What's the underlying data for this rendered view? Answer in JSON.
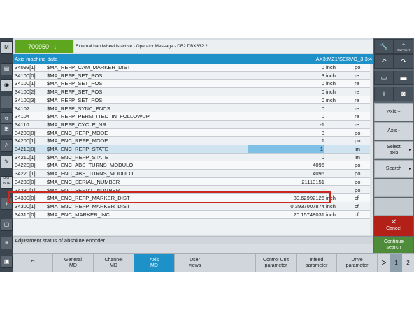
{
  "header": {
    "alarm_number": "700950",
    "alarm_arrow": "↓",
    "message": "External handwheel is active - Operator Message -   DB2.DBX632.2"
  },
  "window": {
    "title": "Axis machine data",
    "path": "AX3:MZ1/SERVO_3.3:4"
  },
  "table": {
    "rows": [
      {
        "num": "34093[1]",
        "name": "$MA_REFP_CAM_MARKER_DIST",
        "value": "0",
        "unit": "inch",
        "eff": "po"
      },
      {
        "num": "34100[0]",
        "name": "$MA_REFP_SET_POS",
        "value": "3",
        "unit": "inch",
        "eff": "re"
      },
      {
        "num": "34100[1]",
        "name": "$MA_REFP_SET_POS",
        "value": "0",
        "unit": "inch",
        "eff": "re"
      },
      {
        "num": "34100[2]",
        "name": "$MA_REFP_SET_POS",
        "value": "0",
        "unit": "inch",
        "eff": "re"
      },
      {
        "num": "34100[3]",
        "name": "$MA_REFP_SET_POS",
        "value": "0",
        "unit": "inch",
        "eff": "re"
      },
      {
        "num": "34102",
        "name": "$MA_REFP_SYNC_ENCS",
        "value": "0",
        "unit": "",
        "eff": "re"
      },
      {
        "num": "34104",
        "name": "$MA_REFP_PERMITTED_IN_FOLLOWUP",
        "value": "0",
        "unit": "",
        "eff": "re"
      },
      {
        "num": "34110",
        "name": "$MA_REFP_CYCLE_NR",
        "value": "-1",
        "unit": "",
        "eff": "re"
      },
      {
        "num": "34200[0]",
        "name": "$MA_ENC_REFP_MODE",
        "value": "0",
        "unit": "",
        "eff": "po"
      },
      {
        "num": "34200[1]",
        "name": "$MA_ENC_REFP_MODE",
        "value": "1",
        "unit": "",
        "eff": "po"
      },
      {
        "num": "34210[0]",
        "name": "$MA_ENC_REFP_STATE",
        "value": "1",
        "unit": "",
        "eff": "im"
      },
      {
        "num": "34210[1]",
        "name": "$MA_ENC_REFP_STATE",
        "value": "0",
        "unit": "",
        "eff": "im"
      },
      {
        "num": "34220[0]",
        "name": "$MA_ENC_ABS_TURNS_MODULO",
        "value": "4096",
        "unit": "",
        "eff": "po"
      },
      {
        "num": "34220[1]",
        "name": "$MA_ENC_ABS_TURNS_MODULO",
        "value": "4096",
        "unit": "",
        "eff": "po"
      },
      {
        "num": "34230[0]",
        "name": "$MA_ENC_SERIAL_NUMBER",
        "value": "21113151",
        "unit": "",
        "eff": "po"
      },
      {
        "num": "34230[1]",
        "name": "$MA_ENC_SERIAL_NUMBER",
        "value": "0",
        "unit": "",
        "eff": "po"
      },
      {
        "num": "34300[0]",
        "name": "$MA_ENC_REFP_MARKER_DIST",
        "value": "80.62992126",
        "unit": "inch",
        "eff": "cf"
      },
      {
        "num": "34300[1]",
        "name": "$MA_ENC_REFP_MARKER_DIST",
        "value": "0.3937007874",
        "unit": "inch",
        "eff": "cf"
      },
      {
        "num": "34310[0]",
        "name": "$MA_ENC_MARKER_INC",
        "value": "20.15748031",
        "unit": "inch",
        "eff": "cf"
      }
    ]
  },
  "status_text": "Adjustment status of absolute encoder",
  "right_softkeys": {
    "icons": [
      "wrench-icon",
      "rs-point-icon",
      "undo-icon",
      "redo-icon",
      "window-icon",
      "window-alt-icon",
      "info-icon",
      "screenshot-icon"
    ],
    "rs_point_label": "RS POINT",
    "axis_plus": "Axis +",
    "axis_minus": "Axis -",
    "select_axis": "Select axis",
    "search": "Search",
    "cancel_icon": "✕",
    "cancel": "Cancel",
    "continue_search": "Continue search"
  },
  "bottom_softkeys": {
    "up_arrow": "⌃",
    "general_md": "General MD",
    "channel_md": "Channel MD",
    "axis_md": "Axis MD",
    "user_views": "User views",
    "control_unit_parameter": "Control Unit parameter",
    "infeed_parameter": "Infeed parameter",
    "drive_parameter": "Drive parameter",
    "next_arrow": ">",
    "page1": "1",
    "page2": "2"
  },
  "left_rail": {
    "m_label": "M",
    "sinu_label": "SINU INTE"
  }
}
